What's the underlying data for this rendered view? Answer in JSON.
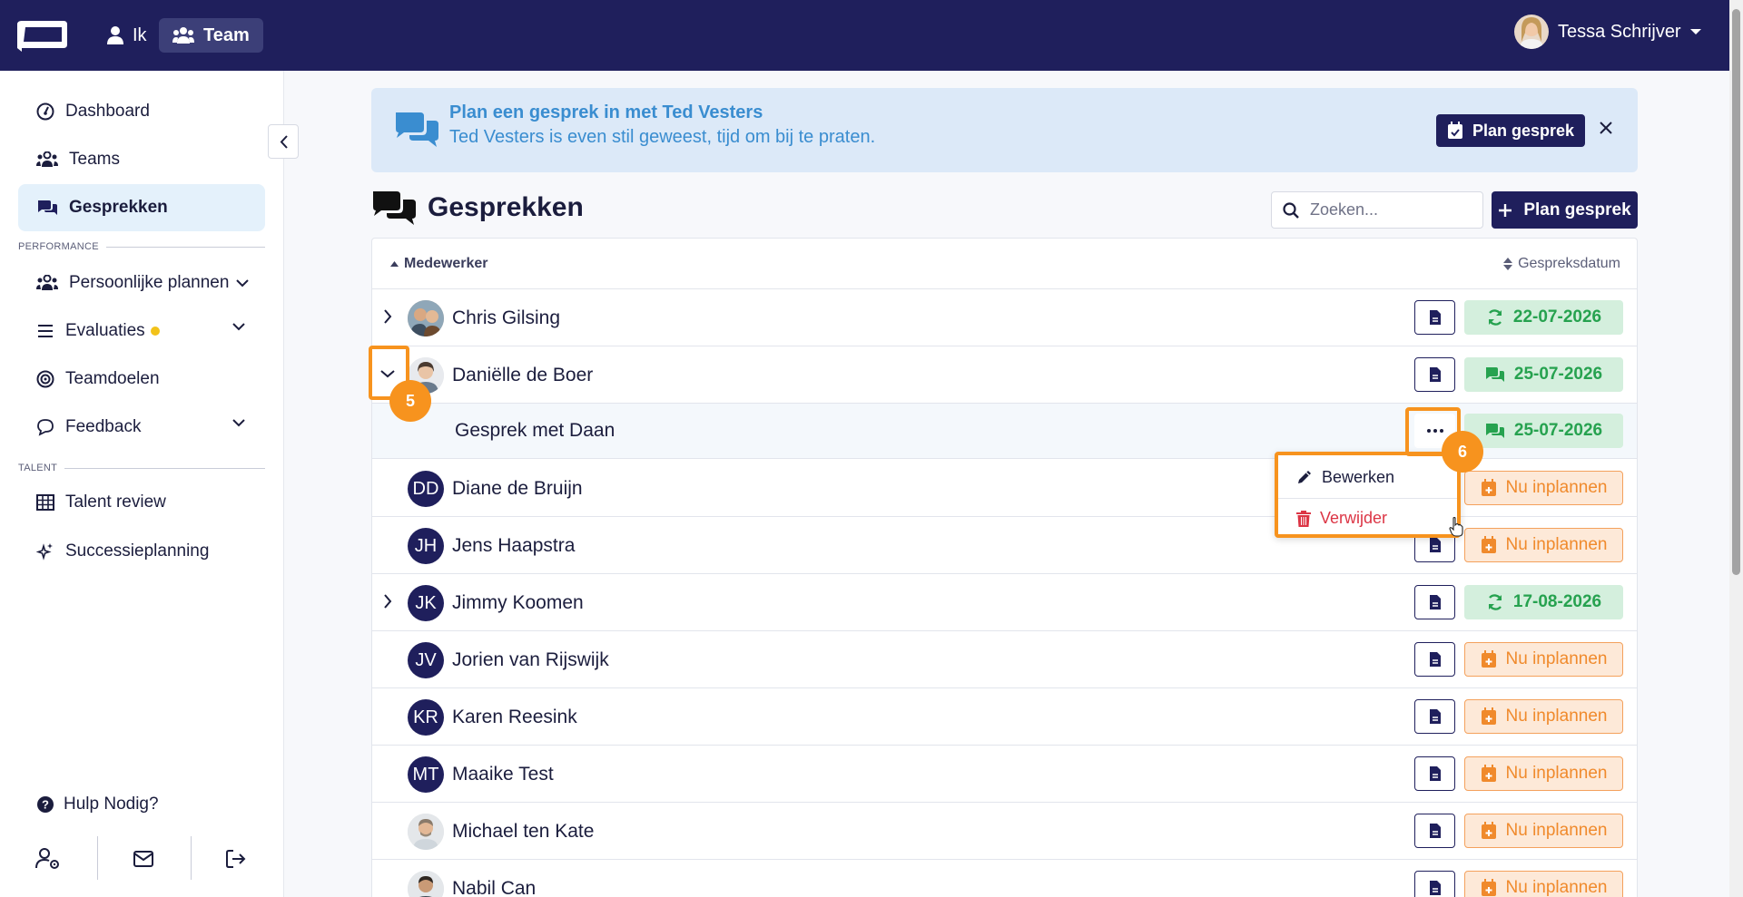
{
  "topbar": {
    "nav_ik": "Ik",
    "nav_team": "Team",
    "user_name": "Tessa Schrijver"
  },
  "sidebar": {
    "items": [
      {
        "label": "Dashboard",
        "icon": "gauge-icon"
      },
      {
        "label": "Teams",
        "icon": "users-icon"
      },
      {
        "label": "Gesprekken",
        "icon": "comments-icon",
        "active": true
      },
      {
        "label": "Persoonlijke plannen",
        "icon": "users-icon"
      },
      {
        "label": "Evaluaties",
        "icon": "list-icon"
      },
      {
        "label": "Teamdoelen",
        "icon": "target-icon"
      },
      {
        "label": "Feedback",
        "icon": "comment-icon"
      },
      {
        "label": "Talent review",
        "icon": "grid-icon"
      },
      {
        "label": "Successieplanning",
        "icon": "sparkles-icon"
      }
    ],
    "section_performance": "PERFORMANCE",
    "section_talent": "TALENT",
    "help": "Hulp Nodig?"
  },
  "banner": {
    "title": "Plan een gesprek in met Ted Vesters",
    "text": "Ted Vesters is even stil geweest, tijd om bij te praten.",
    "button": "Plan gesprek"
  },
  "main": {
    "title": "Gesprekken",
    "search_placeholder": "Zoeken...",
    "new_button": "Plan gesprek",
    "col_employee": "Medewerker",
    "col_date": "Gespreksdatum"
  },
  "rows": [
    {
      "name": "Chris Gilsing",
      "initials": "",
      "badge": "22-07-2026",
      "badge_type": "recurring",
      "expander": "right"
    },
    {
      "name": "Daniëlle de Boer",
      "initials": "",
      "badge": "25-07-2026",
      "badge_type": "done",
      "expander": "down"
    },
    {
      "name": "Gesprek met Daan",
      "badge": "25-07-2026",
      "badge_type": "done",
      "sub": true
    },
    {
      "name": "Diane de Bruijn",
      "initials": "DD",
      "badge": "Nu inplannen",
      "badge_type": "plan"
    },
    {
      "name": "Jens Haapstra",
      "initials": "JH",
      "badge": "Nu inplannen",
      "badge_type": "plan"
    },
    {
      "name": "Jimmy Koomen",
      "initials": "JK",
      "badge": "17-08-2026",
      "badge_type": "recurring",
      "expander": "right"
    },
    {
      "name": "Jorien van Rijswijk",
      "initials": "JV",
      "badge": "Nu inplannen",
      "badge_type": "plan"
    },
    {
      "name": "Karen Reesink",
      "initials": "KR",
      "badge": "Nu inplannen",
      "badge_type": "plan"
    },
    {
      "name": "Maaike Test",
      "initials": "MT",
      "badge": "Nu inplannen",
      "badge_type": "plan"
    },
    {
      "name": "Michael ten Kate",
      "initials": "",
      "badge": "Nu inplannen",
      "badge_type": "plan"
    },
    {
      "name": "Nabil Can",
      "initials": "",
      "badge": "Nu inplannen",
      "badge_type": "plan"
    }
  ],
  "dropdown": {
    "edit": "Bewerken",
    "delete": "Verwijder"
  },
  "annotations": {
    "step5": "5",
    "step6": "6"
  },
  "colors": {
    "brand": "#1f1f5c",
    "accent_orange": "#f7931e",
    "success": "#26a24f",
    "danger": "#dc3545",
    "info": "#3a8dd0"
  }
}
